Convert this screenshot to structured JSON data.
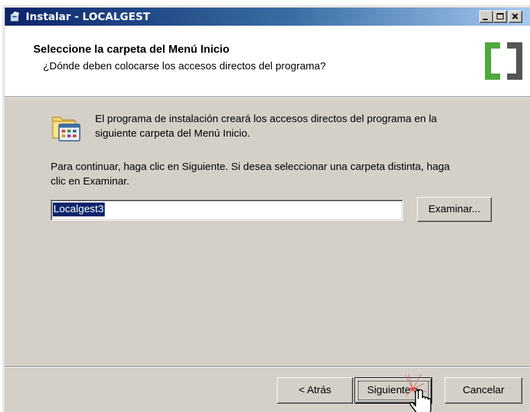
{
  "window": {
    "title": "Instalar - LOCALGEST"
  },
  "header": {
    "title": "Seleccione la carpeta del Menú Inicio",
    "subtitle": "¿Dónde deben colocarse los accesos directos del programa?",
    "logo_color": "#4fa83d"
  },
  "body": {
    "intro_line1": "El programa de instalación creará los accesos directos del programa en la",
    "intro_line2": "siguiente carpeta del Menú Inicio.",
    "instructions_line1": "Para continuar, haga clic en Siguiente. Si desea seleccionar una carpeta distinta, haga",
    "instructions_line2": "clic en Examinar.",
    "folder_value": "Localgest3",
    "browse_button": "Examinar..."
  },
  "footer": {
    "back_button": "< Atrás",
    "next_button": "Siguiente >",
    "cancel_button": "Cancelar"
  },
  "icons": {
    "app_icon": "setup-icon",
    "folder_icon": "start-menu-folder-icon",
    "cursor": "hand-pointer-icon"
  }
}
